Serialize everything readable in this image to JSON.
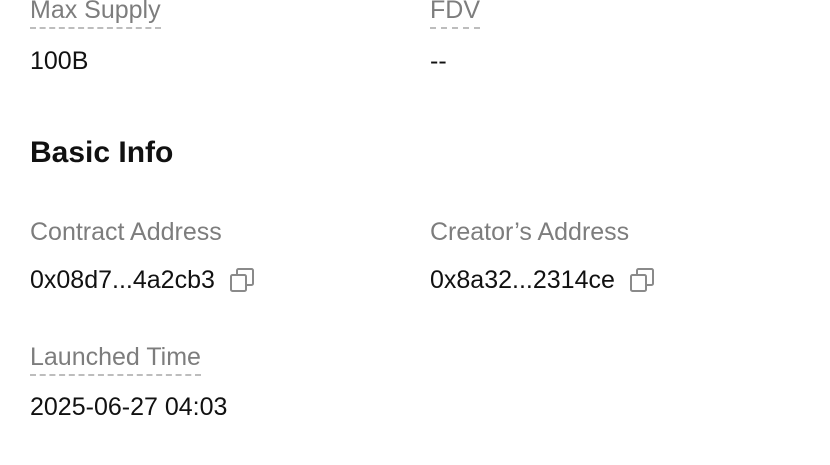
{
  "supply": {
    "max_supply_label": "Max Supply",
    "max_supply_value": "100B",
    "fdv_label": "FDV",
    "fdv_value": "--"
  },
  "basic_info": {
    "title": "Basic Info",
    "contract_address_label": "Contract Address",
    "contract_address_value": "0x08d7...4a2cb3",
    "creator_address_label": "Creator’s Address",
    "creator_address_value": "0x8a32...2314ce",
    "launched_time_label": "Launched Time",
    "launched_time_value": "2025-06-27 04:03"
  },
  "icons": {
    "copy": "copy-icon"
  },
  "colors": {
    "label": "#7d7d7d",
    "value": "#111111",
    "dashed_underline": "#bdbdbd",
    "background": "#ffffff"
  }
}
